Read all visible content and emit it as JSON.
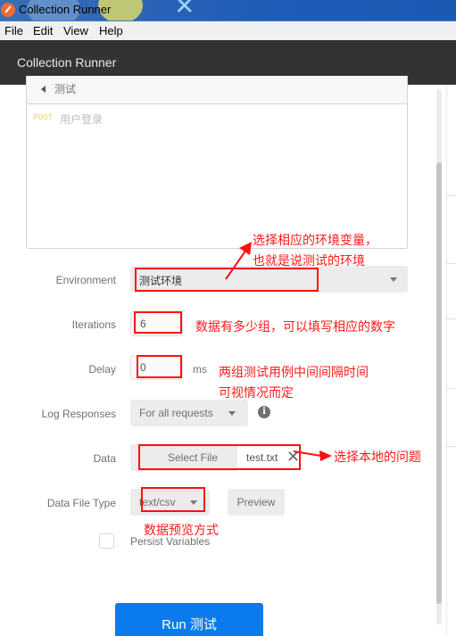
{
  "window": {
    "title": "Collection Runner"
  },
  "menu": {
    "items": [
      "File",
      "Edit",
      "View",
      "Help"
    ]
  },
  "header": {
    "title": "Collection Runner"
  },
  "collection": {
    "name": "测试",
    "requests": [
      {
        "method": "POST",
        "name": "用户登录"
      }
    ]
  },
  "form": {
    "environment": {
      "label": "Environment",
      "value": "测试环境"
    },
    "iterations": {
      "label": "Iterations",
      "value": "6"
    },
    "delay": {
      "label": "Delay",
      "value": "0",
      "unit": "ms"
    },
    "log_responses": {
      "label": "Log Responses",
      "value": "For all requests"
    },
    "data": {
      "label": "Data",
      "select_file_label": "Select File",
      "file_name": "test.txt"
    },
    "data_file_type": {
      "label": "Data File Type",
      "value": "text/csv",
      "preview_label": "Preview"
    },
    "persist_variables": {
      "label": "Persist Variables",
      "checked": false
    },
    "run_button": "Run 测试"
  },
  "annotations": {
    "environment_line1": "选择相应的环境变量，",
    "environment_line2": "也就是说测试的环境",
    "iterations": "数据有多少组，可以填写相应的数字",
    "delay_line1": "两组测试用例中间间隔时间",
    "delay_line2": "可视情况而定",
    "data": "选择本地的问题",
    "data_file_type": "数据预览方式"
  },
  "colors": {
    "accent": "#097bed",
    "annotation": "#ff1010",
    "header_bg": "#333333",
    "post_method": "#f9d88a"
  }
}
